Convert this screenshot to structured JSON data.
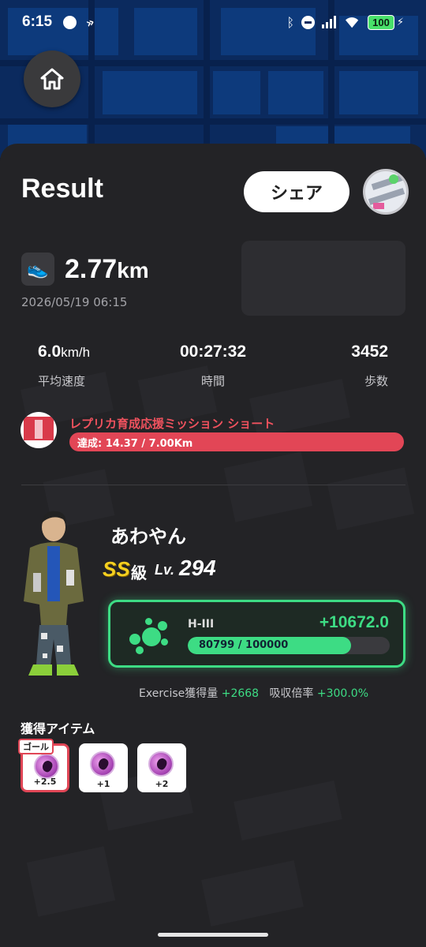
{
  "status_bar": {
    "time": "6:15",
    "battery": "100"
  },
  "header": {
    "title": "Result",
    "share_label": "シェア"
  },
  "run": {
    "distance_value": "2.77",
    "distance_unit": "km",
    "datetime": "2026/05/19 06:15"
  },
  "stats": [
    {
      "value": "6.0",
      "unit": "km/h",
      "label": "平均速度"
    },
    {
      "value": "00:27:32",
      "unit": "",
      "label": "時間"
    },
    {
      "value": "3452",
      "unit": "",
      "label": "歩数"
    }
  ],
  "mission": {
    "title": "レプリカ育成応援ミッション ショート",
    "progress_text": "達成: 14.37 / 7.00Km"
  },
  "character": {
    "name": "あわやん",
    "rank": "SS",
    "rank_suffix": "級",
    "level_label": "Lv.",
    "level": "294"
  },
  "exp": {
    "grade": "H-III",
    "gain": "+10672.0",
    "current": 80799,
    "max": 100000,
    "progress_text": "80799 / 100000",
    "fill_fraction": 0.81
  },
  "exercise": {
    "label": "Exercise獲得量",
    "value": "+2668",
    "rate_label": "吸収倍率",
    "rate_value": "+300.0%"
  },
  "items": {
    "title": "獲得アイテム",
    "goal_tag": "ゴール",
    "list": [
      {
        "count": "+2.5"
      },
      {
        "count": "+1"
      },
      {
        "count": "+2"
      }
    ]
  },
  "colors": {
    "accent_green": "#3ddc84",
    "mission_red": "#e24656",
    "sheet_bg": "#232326"
  },
  "icons": {
    "home": "home-icon",
    "shoe": "running-shoe-icon",
    "exp": "blob-icon",
    "item": "orb-icon"
  }
}
